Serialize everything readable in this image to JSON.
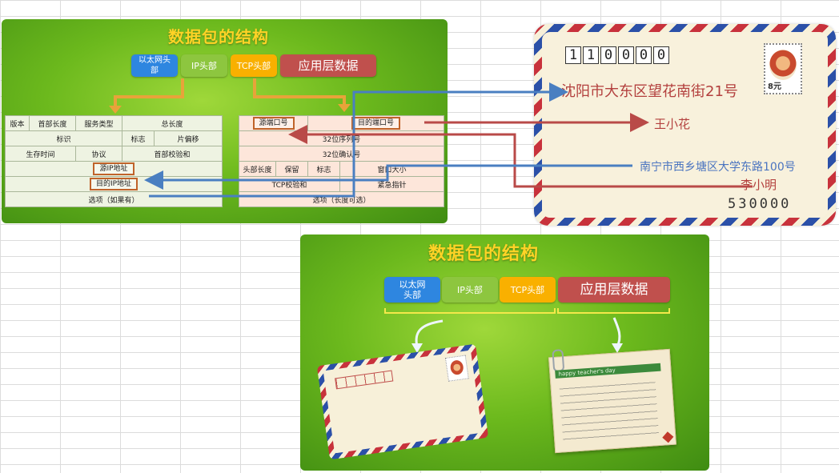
{
  "slide_top": {
    "title": "数据包的结构",
    "chips": {
      "ethernet": "以太网头部",
      "ip": "IP头部",
      "tcp": "TCP头部",
      "app": "应用层数据"
    },
    "ip_header": {
      "row1": [
        "版本",
        "首部长度",
        "服务类型",
        "总长度"
      ],
      "row2": [
        "标识",
        "标志",
        "片偏移"
      ],
      "row3": [
        "生存时间",
        "协议",
        "首部校验和"
      ],
      "row4": "源IP地址",
      "row5": "目的IP地址",
      "row6": "选项（如果有）"
    },
    "tcp_header": {
      "row1": [
        "源端口号",
        "目的端口号"
      ],
      "row2": "32位序列号",
      "row3": "32位确认号",
      "row4": [
        "头部长度",
        "保留",
        "标志",
        "窗口大小"
      ],
      "row5": [
        "TCP校验和",
        "紧急指针"
      ],
      "row6": "选项（长度可选）"
    }
  },
  "envelope": {
    "zip_to": [
      "1",
      "1",
      "0",
      "0",
      "0",
      "0"
    ],
    "stamp_value": "8元",
    "to_address": "沈阳市大东区望花南街21号",
    "to_name": "王小花",
    "from_address": "南宁市西乡塘区大学东路100号",
    "from_name": "李小明",
    "zip_from": "530000"
  },
  "slide_bottom": {
    "title": "数据包的结构",
    "chips": {
      "ethernet": "以太网头部",
      "ip": "IP头部",
      "tcp": "TCP头部",
      "app": "应用层数据"
    },
    "card_heading": "happy teacher's day"
  },
  "colors": {
    "arrow_blue": "#4a7fc1",
    "arrow_red": "#b94a48",
    "title_yellow": "#ffd326",
    "accent_orange": "#e8a33a"
  }
}
